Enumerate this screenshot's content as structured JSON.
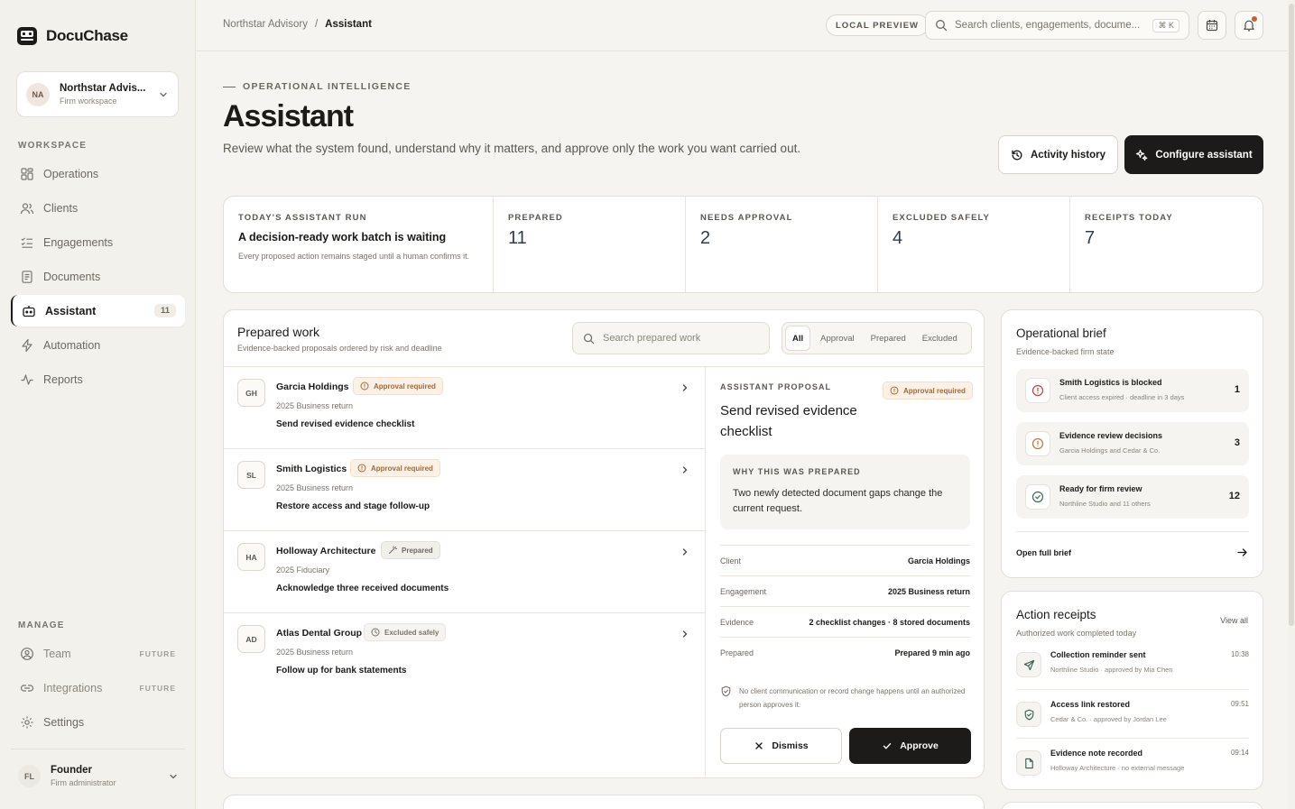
{
  "app": {
    "name": "DocuChase"
  },
  "workspace": {
    "initials": "NA",
    "name": "Northstar Advis...",
    "type": "Firm workspace"
  },
  "sidebar": {
    "workspace_label": "WORKSPACE",
    "items": [
      {
        "label": "Operations",
        "icon": "grid-icon"
      },
      {
        "label": "Clients",
        "icon": "users-icon"
      },
      {
        "label": "Engagements",
        "icon": "list-check-icon"
      },
      {
        "label": "Documents",
        "icon": "document-icon"
      },
      {
        "label": "Assistant",
        "icon": "bot-icon",
        "count": "11",
        "active": true
      },
      {
        "label": "Automation",
        "icon": "bolt-icon"
      },
      {
        "label": "Reports",
        "icon": "pulse-icon"
      }
    ],
    "manage_label": "MANAGE",
    "manage_items": [
      {
        "label": "Team",
        "tag": "FUTURE",
        "icon": "person-circle-icon"
      },
      {
        "label": "Integrations",
        "tag": "FUTURE",
        "icon": "link-icon"
      },
      {
        "label": "Settings",
        "icon": "gear-icon"
      }
    ],
    "user": {
      "initials": "FL",
      "name": "Founder",
      "role": "Firm administrator"
    }
  },
  "topbar": {
    "breadcrumb": [
      "Northstar Advisory",
      "/",
      "Assistant"
    ],
    "preview_badge": "LOCAL PREVIEW",
    "search_placeholder": "Search clients, engagements, docume...",
    "shortcut": "⌘ K"
  },
  "header": {
    "eyebrow": "OPERATIONAL INTELLIGENCE",
    "title": "Assistant",
    "subtitle": "Review what the system found, understand why it matters, and approve only the work you want carried out.",
    "history_label": "Activity history",
    "configure_label": "Configure assistant"
  },
  "stats": {
    "run_label": "TODAY'S ASSISTANT RUN",
    "run_headline": "A decision-ready work batch is waiting",
    "run_note": "Every proposed action remains staged until a human confirms it.",
    "cards": [
      {
        "label": "PREPARED",
        "value": "11"
      },
      {
        "label": "NEEDS APPROVAL",
        "value": "2"
      },
      {
        "label": "EXCLUDED SAFELY",
        "value": "4"
      },
      {
        "label": "RECEIPTS TODAY",
        "value": "7"
      }
    ]
  },
  "prepared_work": {
    "title": "Prepared work",
    "subtitle": "Evidence-backed proposals ordered by risk and deadline",
    "search_placeholder": "Search prepared work",
    "filters": [
      "All",
      "Approval",
      "Prepared",
      "Excluded"
    ],
    "rows": [
      {
        "initials": "GH",
        "client": "Garcia Holdings",
        "status": "Approval required",
        "kind": "approval",
        "type": "2025 Business return",
        "action": "Send revised evidence checklist"
      },
      {
        "initials": "SL",
        "client": "Smith Logistics",
        "status": "Approval required",
        "kind": "approval",
        "type": "2025 Business return",
        "action": "Restore access and stage follow-up"
      },
      {
        "initials": "HA",
        "client": "Holloway Architecture",
        "status": "Prepared",
        "kind": "prepared",
        "type": "2025 Fiduciary",
        "action": "Acknowledge three received documents"
      },
      {
        "initials": "AD",
        "client": "Atlas Dental Group",
        "status": "Excluded safely",
        "kind": "excluded",
        "type": "2025 Business return",
        "action": "Follow up for bank statements"
      }
    ]
  },
  "proposal": {
    "eyebrow": "ASSISTANT PROPOSAL",
    "status": "Approval required",
    "title": "Send revised evidence checklist",
    "why_label": "WHY THIS WAS PREPARED",
    "why_text": "Two newly detected document gaps change the current request.",
    "details": [
      {
        "key": "Client",
        "value": "Garcia Holdings"
      },
      {
        "key": "Engagement",
        "value": "2025 Business return"
      },
      {
        "key": "Evidence",
        "value": "2 checklist changes · 8 stored documents"
      },
      {
        "key": "Prepared",
        "value": "Prepared 9 min ago"
      }
    ],
    "note": "No client communication or record change happens until an authorized person approves it.",
    "dismiss_label": "Dismiss",
    "approve_label": "Approve"
  },
  "brief": {
    "title": "Operational brief",
    "subtitle": "Evidence-backed firm state",
    "items": [
      {
        "title": "Smith Logistics is blocked",
        "detail": "Client access expired · deadline in 3 days",
        "count": "1",
        "icon": "alert-circle-icon",
        "color": "#c0433a"
      },
      {
        "title": "Evidence review decisions",
        "detail": "Garcia Holdings and Cedar & Co.",
        "count": "3",
        "icon": "alert-circle-icon",
        "color": "#b8763b"
      },
      {
        "title": "Ready for firm review",
        "detail": "Northline Studio and 11 others",
        "count": "12",
        "icon": "check-circle-icon",
        "color": "#3d6b55"
      }
    ],
    "link_label": "Open full brief"
  },
  "receipts": {
    "title": "Action receipts",
    "subtitle": "Authorized work completed today",
    "view_all": "View all",
    "items": [
      {
        "title": "Collection reminder sent",
        "detail": "Northline Studio · approved by Mia Chen",
        "time": "10:38",
        "icon": "send-icon"
      },
      {
        "title": "Access link restored",
        "detail": "Cedar & Co. · approved by Jordan Lee",
        "time": "09:51",
        "icon": "shield-check-icon"
      },
      {
        "title": "Evidence note recorded",
        "detail": "Holloway Architecture · no external message",
        "time": "09:14",
        "icon": "file-icon"
      }
    ]
  }
}
